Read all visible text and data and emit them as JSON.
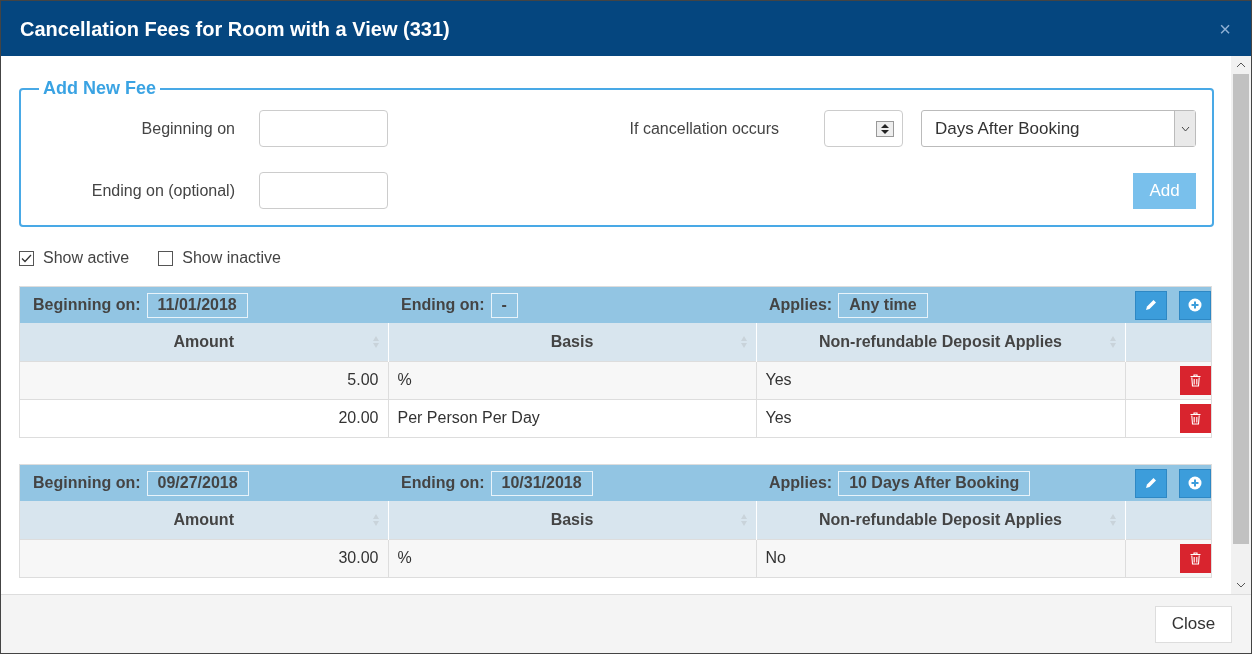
{
  "window": {
    "title": "Cancellation Fees for Room with a View (331)",
    "close_glyph": "×"
  },
  "add_fee": {
    "legend": "Add New Fee",
    "beginning_label": "Beginning on",
    "ending_label": "Ending on (optional)",
    "occurs_label": "If cancellation occurs",
    "basis_select": "Days After Booking",
    "add_button": "Add"
  },
  "filters": [
    {
      "label": "Show active",
      "checked": true
    },
    {
      "label": "Show inactive",
      "checked": false
    }
  ],
  "fee_groups": [
    {
      "beginning_label": "Beginning on:",
      "beginning": "11/01/2018",
      "ending_label": "Ending on:",
      "ending": "-",
      "applies_label": "Applies:",
      "applies": "Any time",
      "columns": [
        "Amount",
        "Basis",
        "Non-refundable Deposit Applies"
      ],
      "rows": [
        {
          "amount": "5.00",
          "basis": "%",
          "deposit": "Yes"
        },
        {
          "amount": "20.00",
          "basis": "Per Person Per Day",
          "deposit": "Yes"
        }
      ]
    },
    {
      "beginning_label": "Beginning on:",
      "beginning": "09/27/2018",
      "ending_label": "Ending on:",
      "ending": "10/31/2018",
      "applies_label": "Applies:",
      "applies": "10 Days After Booking",
      "columns": [
        "Amount",
        "Basis",
        "Non-refundable Deposit Applies"
      ],
      "rows": [
        {
          "amount": "30.00",
          "basis": "%",
          "deposit": "No"
        }
      ]
    }
  ],
  "footer": {
    "close_button": "Close"
  }
}
